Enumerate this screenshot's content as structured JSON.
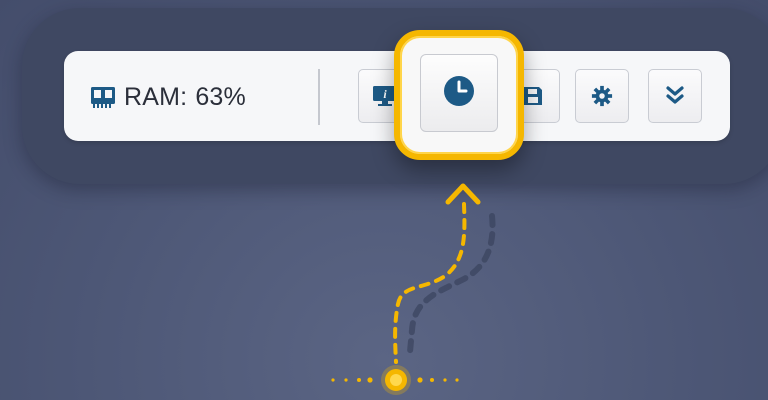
{
  "toolbar": {
    "ram_label": "RAM:",
    "ram_value": "63%"
  },
  "icons": {
    "ram": "ram-chip-icon",
    "info": "monitor-info-icon",
    "clock": "clock-icon",
    "save": "save-disk-icon",
    "settings": "gear-icon",
    "more": "double-chevron-down-icon"
  },
  "colors": {
    "accent": "#f5b700",
    "icon_blue": "#1d5a86",
    "dock": "#3f4862",
    "background": "#4d5776"
  }
}
